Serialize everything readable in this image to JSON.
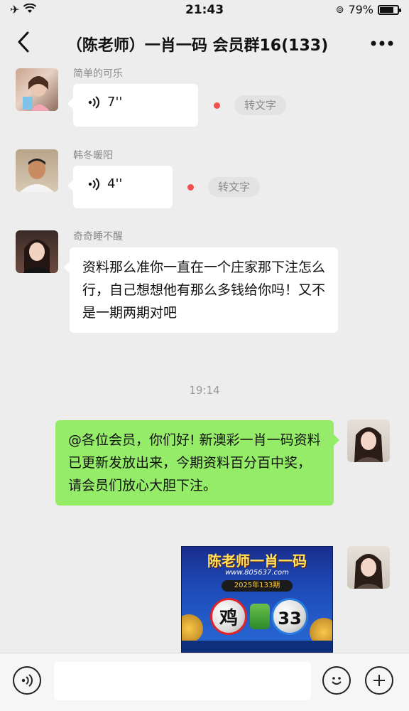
{
  "status_bar": {
    "time": "21:43",
    "battery_percent": "79%",
    "battery_level": 0.79
  },
  "nav": {
    "title": "（陈老师）一肖一码 会员群16(133)"
  },
  "messages": [
    {
      "type": "voice",
      "sender": "简单的可乐",
      "duration": "7''",
      "transcribe": "转文字"
    },
    {
      "type": "voice",
      "sender": "韩冬暖阳",
      "duration": "4''",
      "transcribe": "转文字"
    },
    {
      "type": "text",
      "sender": "奇奇睡不醒",
      "text": "资料那么准你一直在一个庄家那下注怎么行，自己想想他有那么多钱给你吗！又不是一期两期对吧"
    },
    {
      "type": "timestamp",
      "text": "19:14"
    },
    {
      "type": "text_self",
      "text": "@各位会员，你们好! 新澳彩一肖一码资料已更新发放出来，今期资料百分百中奖，请会员们放心大胆下注。"
    },
    {
      "type": "image_self"
    }
  ],
  "poster": {
    "title": "陈老师一肖一码",
    "url": "www.805637.com",
    "issue": "2025年133期",
    "zodiac": "鸡",
    "number": "33"
  },
  "colors": {
    "self_bubble": "#95ec69",
    "unread_dot": "#f0504c",
    "background": "#ededed"
  },
  "input_bar": {
    "voice_icon": "voice-icon",
    "emoji_icon": "emoji-icon",
    "plus_icon": "plus-icon"
  }
}
